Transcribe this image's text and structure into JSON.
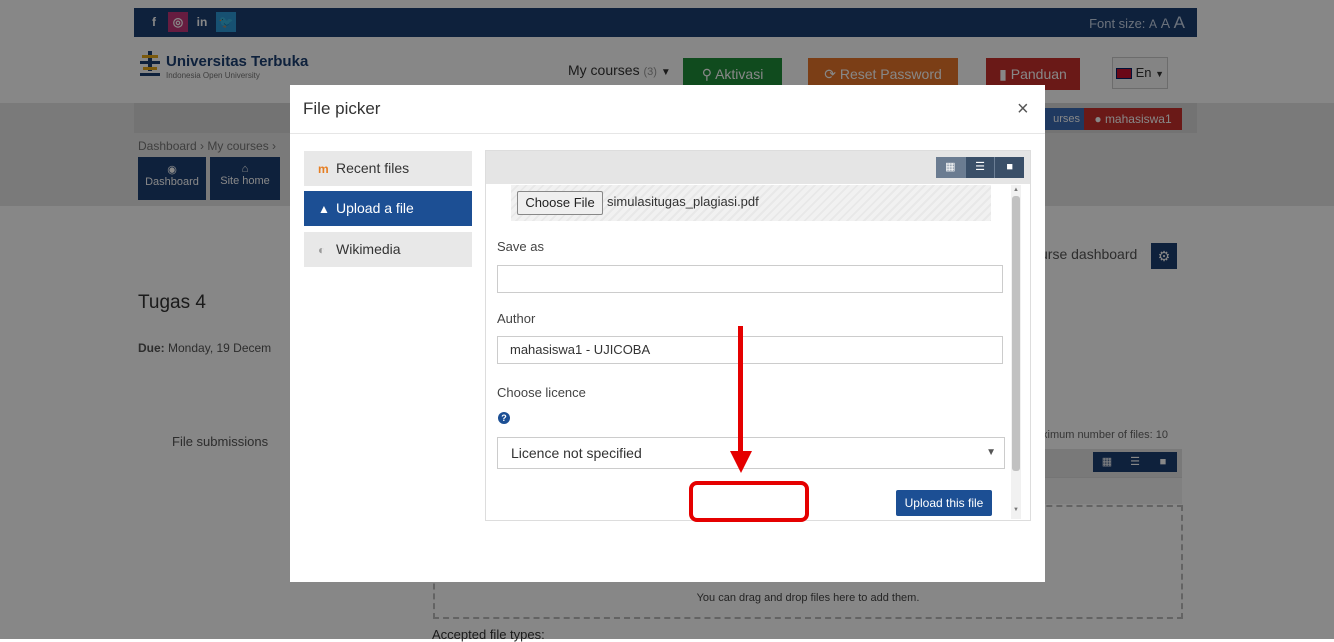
{
  "topbar": {
    "social": [
      "f",
      "◎",
      "in",
      "🐦"
    ],
    "font_size_label": "Font size:",
    "font_sizes": [
      "A",
      "A",
      "A"
    ]
  },
  "navbar": {
    "brand_name": "Universitas Terbuka",
    "brand_tagline": "Indonesia Open University",
    "my_courses_label": "My courses",
    "my_courses_count": "(3)",
    "aktivasi_label": "Aktivasi",
    "reset_password_label": "Reset Password",
    "panduan_label": "Panduan",
    "lang_label": "En"
  },
  "subnav": {
    "courses_label": "urses",
    "user_label": "mahasiswa1"
  },
  "breadcrumb": "Dashboard › My courses ›",
  "quick_links": {
    "dashboard": "Dashboard",
    "site_home": "Site home"
  },
  "course_dashboard_label": "urse dashboard",
  "page_title": "Tugas 4",
  "due": {
    "label": "Due:",
    "value": "Monday, 19 Decem"
  },
  "file_submissions_label": "File submissions",
  "max_files_label": "ximum number of files: 10",
  "dropzone_text": "You can drag and drop files here to add them.",
  "accepted_label": "Accepted file types:",
  "modal": {
    "title": "File picker",
    "close": "×",
    "repositories": [
      {
        "label": "Recent files",
        "icon": "moodle-icon",
        "active": false
      },
      {
        "label": "Upload a file",
        "icon": "upload-icon",
        "active": true
      },
      {
        "label": "Wikimedia",
        "icon": "wikimedia-icon",
        "active": false
      }
    ],
    "choose_file_label": "Choose File",
    "chosen_file_name": "simulasitugas_plagiasi.pdf",
    "save_as_label": "Save as",
    "save_as_value": "",
    "author_label": "Author",
    "author_value": "mahasiswa1 - UJICOBA",
    "licence_label": "Choose licence",
    "licence_value": "Licence not specified",
    "upload_button_label": "Upload this file"
  },
  "colors": {
    "primary": "#1c3f72",
    "modal_primary": "#1c4f94",
    "aktivasi": "#1f8f3a",
    "reset": "#e9762b",
    "panduan": "#c9302c",
    "annotation": "#e50000"
  }
}
